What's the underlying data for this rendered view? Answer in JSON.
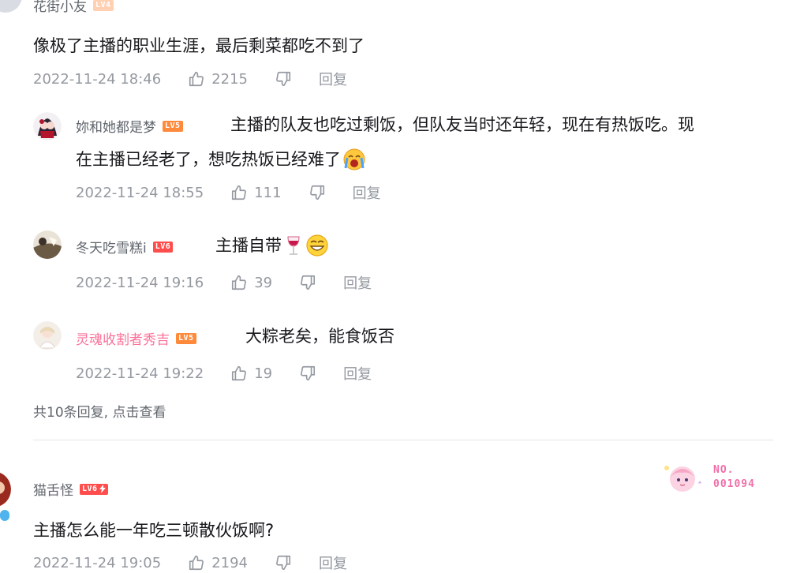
{
  "comments": [
    {
      "user": "花街小友",
      "level": "LV4",
      "text": "像极了主播的职业生涯，最后剩菜都吃不到了",
      "date": "2022-11-24 18:46",
      "likes": "2215",
      "reply_label": "回复"
    },
    {
      "user": "猫舌怪",
      "level": "LV6",
      "text": "主播怎么能一年吃三顿散伙饭啊?",
      "date": "2022-11-24 19:05",
      "likes": "2194",
      "reply_label": "回复",
      "fan_badge": "NO.\n001094"
    }
  ],
  "replies": [
    {
      "user": "妳和她都是梦",
      "level": "LV5",
      "text_line1": "主播的队友也吃过剩饭，但队友当时还年轻，现在有热饭吃。现",
      "text_line2": "在主播已经老了，想吃热饭已经难了",
      "date": "2022-11-24 18:55",
      "likes": "111",
      "reply_label": "回复"
    },
    {
      "user": "冬天吃雪糕i",
      "level": "LV6",
      "text": "主播自带",
      "date": "2022-11-24 19:16",
      "likes": "39",
      "reply_label": "回复"
    },
    {
      "user": "灵魂收割者秀吉",
      "level": "LV5",
      "text": "大粽老矣，能食饭否",
      "date": "2022-11-24 19:22",
      "likes": "19",
      "reply_label": "回复"
    }
  ],
  "view_more": "共10条回复, 点击查看",
  "fan_badge_line1": "NO.",
  "fan_badge_line2": "001094",
  "icons": [
    "thumbs-up-icon",
    "thumbs-down-icon",
    "wine-glass-emoji",
    "grin-emoji",
    "crying-emoji",
    "lightning-icon"
  ],
  "colors": {
    "pink_name": "#fb7299",
    "meta_gray": "#9499a0",
    "level_red": "#ff4d4d",
    "level_orange": "#ff8a3c"
  }
}
